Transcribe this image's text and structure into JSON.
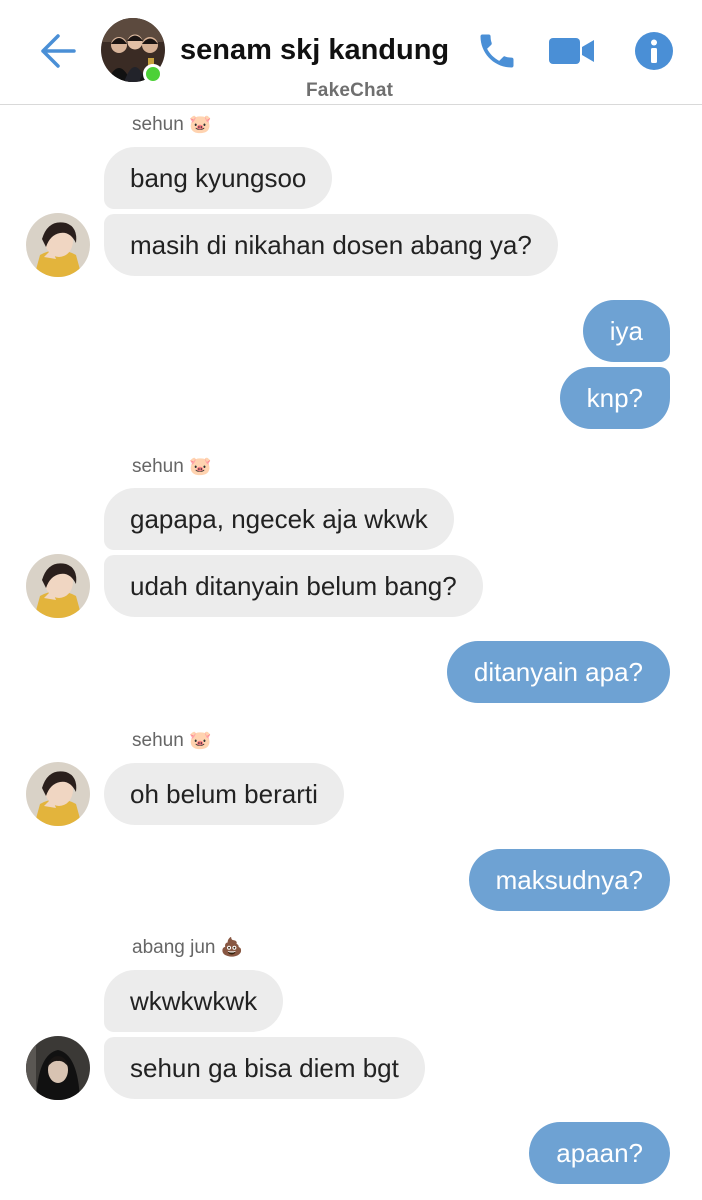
{
  "header": {
    "title": "senam skj kandung",
    "app_brand": "FakeChat",
    "icons": [
      "back-arrow-icon",
      "phone-icon",
      "video-camera-icon",
      "info-icon"
    ],
    "accent_color": "#4a8fd6"
  },
  "messages": [
    {
      "sender": "sehun",
      "sender_emoji": "🐷",
      "side": "in",
      "text": "bang kyungsoo"
    },
    {
      "side": "in",
      "text": "masih di nikahan dosen abang ya?"
    },
    {
      "side": "out",
      "text": "iya"
    },
    {
      "side": "out",
      "text": "knp?"
    },
    {
      "sender": "sehun",
      "sender_emoji": "🐷",
      "side": "in",
      "text": "gapapa, ngecek aja wkwk"
    },
    {
      "side": "in",
      "text": "udah ditanyain belum bang?"
    },
    {
      "side": "out",
      "text": "ditanyain apa?"
    },
    {
      "sender": "sehun",
      "sender_emoji": "🐷",
      "side": "in",
      "text": "oh belum berarti"
    },
    {
      "side": "out",
      "text": "maksudnya?"
    },
    {
      "sender": "abang jun",
      "sender_emoji": "💩",
      "side": "in",
      "text": "wkwkwkwk"
    },
    {
      "side": "in",
      "text": "sehun ga bisa diem bgt"
    },
    {
      "side": "out",
      "text": "apaan?"
    }
  ],
  "colors": {
    "incoming_bubble": "#ececec",
    "outgoing_bubble": "#6ea2d3",
    "online": "#4cd137"
  }
}
